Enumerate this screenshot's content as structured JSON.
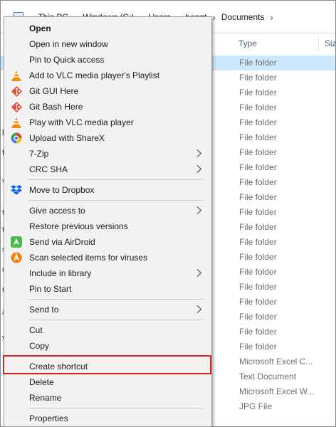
{
  "address": {
    "crumbs": [
      "This PC",
      "Windows (C:)",
      "Users",
      "bengt"
    ],
    "current": "Documents"
  },
  "columns": {
    "type": "Type",
    "size": "Size"
  },
  "file_rows": [
    {
      "type": "File folder",
      "selected": true
    },
    {
      "type": "File folder"
    },
    {
      "type": "File folder"
    },
    {
      "type": "File folder"
    },
    {
      "type": "File folder"
    },
    {
      "type": "File folder"
    },
    {
      "type": "File folder"
    },
    {
      "type": "File folder"
    },
    {
      "type": "File folder"
    },
    {
      "type": "File folder"
    },
    {
      "type": "File folder"
    },
    {
      "type": "File folder"
    },
    {
      "type": "File folder"
    },
    {
      "type": "File folder"
    },
    {
      "type": "File folder"
    },
    {
      "type": "File folder"
    },
    {
      "type": "File folder"
    },
    {
      "type": "File folder"
    },
    {
      "type": "File folder"
    },
    {
      "type": "File folder"
    },
    {
      "type": "Microsoft Excel C..."
    },
    {
      "type": "Text Document"
    },
    {
      "type": "Microsoft Excel W..."
    },
    {
      "type": "JPG File"
    }
  ],
  "left_fragments": [
    "k",
    "f",
    "v",
    "t",
    "t",
    "s",
    "c",
    "r",
    "a",
    "v"
  ],
  "menu": {
    "open": "Open",
    "open_new_window": "Open in new window",
    "pin_quick_access": "Pin to Quick access",
    "vlc_playlist": "Add to VLC media player's Playlist",
    "git_gui": "Git GUI Here",
    "git_bash": "Git Bash Here",
    "vlc_play": "Play with VLC media player",
    "sharex": "Upload with ShareX",
    "seven_zip": "7-Zip",
    "crc_sha": "CRC SHA",
    "dropbox": "Move to Dropbox",
    "give_access": "Give access to",
    "restore_versions": "Restore previous versions",
    "airdroid": "Send via AirDroid",
    "scan_viruses": "Scan selected items for viruses",
    "include_library": "Include in library",
    "pin_start": "Pin to Start",
    "send_to": "Send to",
    "cut": "Cut",
    "copy": "Copy",
    "create_shortcut": "Create shortcut",
    "delete": "Delete",
    "rename": "Rename",
    "properties": "Properties"
  },
  "icons": {
    "vlc": "vlc-cone-icon",
    "git": "git-icon",
    "sharex": "sharex-icon",
    "dropbox": "dropbox-icon",
    "airdroid": "airdroid-icon",
    "avast": "avast-icon"
  },
  "colors": {
    "highlight_border": "#e02020",
    "selection": "#cce8ff",
    "menu_bg": "#f2f2f2"
  }
}
